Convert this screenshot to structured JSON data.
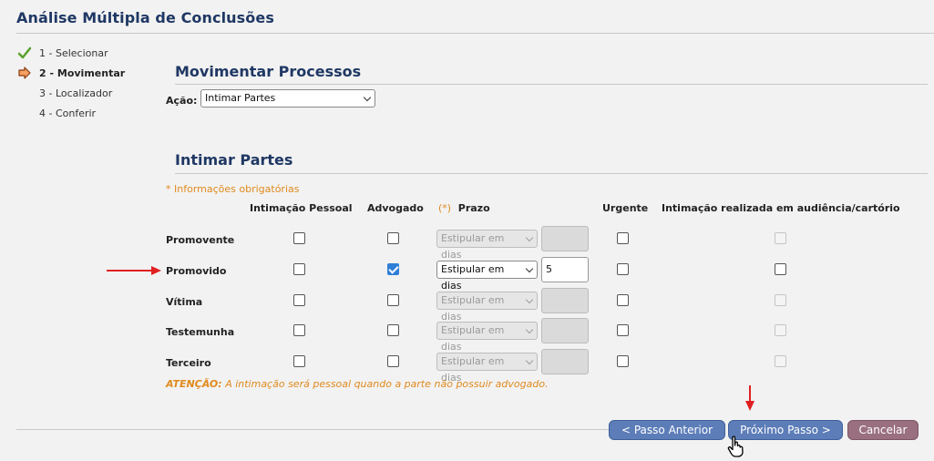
{
  "page": {
    "title": "Análise Múltipla de Conclusões"
  },
  "steps": [
    {
      "label": "1 - Selecionar",
      "state": "done",
      "icon": "check-icon"
    },
    {
      "label": "2 - Movimentar",
      "state": "current",
      "icon": "arrow-right-icon"
    },
    {
      "label": "3 - Localizador",
      "state": "pending"
    },
    {
      "label": "4 - Conferir",
      "state": "pending"
    }
  ],
  "movimentar": {
    "title": "Movimentar Processos",
    "acao_label": "Ação:",
    "acao_value": "Intimar Partes"
  },
  "intimar": {
    "title": "Intimar Partes",
    "required_note": "* Informações obrigatórias",
    "headers": {
      "pessoal": "Intimação Pessoal",
      "advogado": "Advogado",
      "prazo_star": "(*)",
      "prazo": "Prazo",
      "urgente": "Urgente",
      "audiencia": "Intimação realizada em audiência/cartório"
    },
    "rows": [
      {
        "label": "Promovente",
        "pessoal": false,
        "advogado": false,
        "prazo_option": "Estipular em dias",
        "prazo_enabled": false,
        "days": "",
        "urgente": false,
        "audiencia": false,
        "audiencia_enabled": false
      },
      {
        "label": "Promovido",
        "pessoal": false,
        "advogado": true,
        "prazo_option": "Estipular em dias",
        "prazo_enabled": true,
        "days": "5",
        "urgente": false,
        "audiencia": false,
        "audiencia_enabled": true
      },
      {
        "label": "Vítima",
        "pessoal": false,
        "advogado": false,
        "prazo_option": "Estipular em dias",
        "prazo_enabled": false,
        "days": "",
        "urgente": false,
        "audiencia": false,
        "audiencia_enabled": false
      },
      {
        "label": "Testemunha",
        "pessoal": false,
        "advogado": false,
        "prazo_option": "Estipular em dias",
        "prazo_enabled": false,
        "days": "",
        "urgente": false,
        "audiencia": false,
        "audiencia_enabled": false
      },
      {
        "label": "Terceiro",
        "pessoal": false,
        "advogado": false,
        "prazo_option": "Estipular em dias",
        "prazo_enabled": false,
        "days": "",
        "urgente": false,
        "audiencia": false,
        "audiencia_enabled": false
      }
    ],
    "warning_label": "ATENÇÃO:",
    "warning_text": "A intimação será pessoal quando a parte não possuir advogado."
  },
  "buttons": {
    "prev": "< Passo Anterior",
    "next": "Próximo Passo >",
    "cancel": "Cancelar"
  },
  "colors": {
    "title": "#1f3864",
    "accent_orange": "#e08a1e",
    "button_primary": "#5c7db8",
    "button_cancel": "#9a7080",
    "checkbox_checked": "#2f7fd8",
    "annotation_red": "#e02020"
  }
}
